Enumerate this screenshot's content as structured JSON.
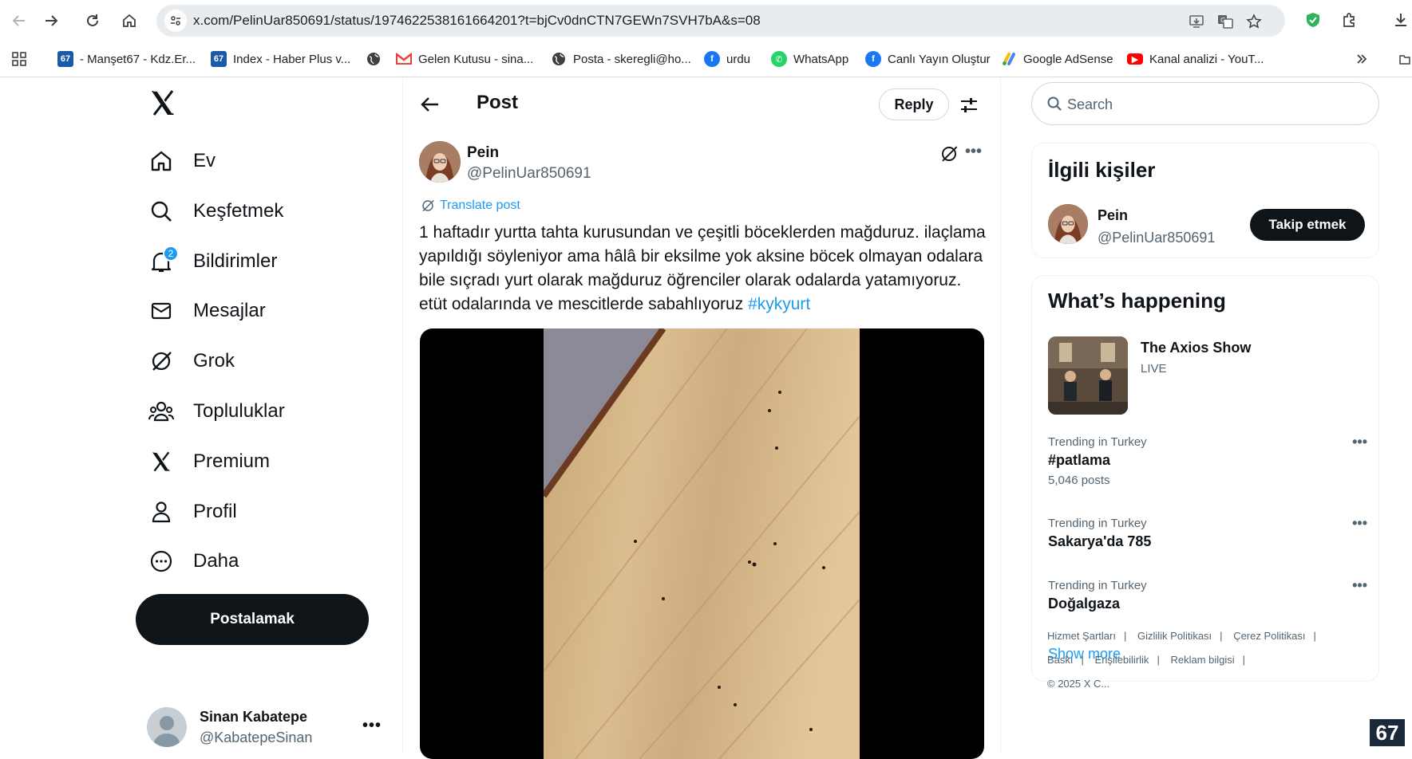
{
  "browser": {
    "url": "x.com/PelinUar850691/status/1974622538161664201?t=bjCv0dnCTN7GEWn7SVH7bA&s=08",
    "bookmarks": [
      {
        "label": "- Manşet67 - Kdz.Er...",
        "icon": "67-favicon"
      },
      {
        "label": "Index - Haber Plus v...",
        "icon": "67-favicon"
      },
      {
        "label": "Gelen Kutusu - sina...",
        "icon": "gmail-icon"
      },
      {
        "label": "Posta - skeregli@ho...",
        "icon": "globe-icon"
      },
      {
        "label": "urdu",
        "icon": "facebook-icon"
      },
      {
        "label": "WhatsApp",
        "icon": "whatsapp-icon"
      },
      {
        "label": "Canlı Yayın Oluştur",
        "icon": "facebook-icon"
      },
      {
        "label": "Google AdSense",
        "icon": "adsense-icon"
      },
      {
        "label": "Kanal analizi - YouT...",
        "icon": "youtube-icon"
      }
    ]
  },
  "nav": {
    "items": [
      {
        "label": "Ev",
        "icon": "home-icon"
      },
      {
        "label": "Keşfetmek",
        "icon": "search-icon"
      },
      {
        "label": "Bildirimler",
        "icon": "bell-icon",
        "badge": "2"
      },
      {
        "label": "Mesajlar",
        "icon": "mail-icon"
      },
      {
        "label": "Grok",
        "icon": "grok-icon"
      },
      {
        "label": "Topluluklar",
        "icon": "communities-icon"
      },
      {
        "label": "Premium",
        "icon": "x-logo-icon"
      },
      {
        "label": "Profil",
        "icon": "person-icon"
      },
      {
        "label": "Daha",
        "icon": "more-circle-icon"
      }
    ],
    "post_button": "Postalamak",
    "account": {
      "name": "Sinan Kabatepe",
      "handle": "@KabatepeSinan",
      "more": "•••"
    }
  },
  "post": {
    "header_title": "Post",
    "reply_label": "Reply",
    "author_name": "Pein",
    "author_handle": "@PelinUar850691",
    "more": "•••",
    "translate_label": "Translate post",
    "text": "1 haftadır yurtta tahta kurusundan ve çeşitli böceklerden mağduruz. ilaçlama yapıldığı söyleniyor ama hâlâ bir eksilme yok aksine böcek olmayan odalara bile sıçradı yurt olarak mağduruz öğrenciler olarak odalarda yatamıyoruz. etüt odalarında ve mescitlerde sabahlıyoruz",
    "hashtag": "#kykyurt"
  },
  "sidebar": {
    "search_placeholder": "Search",
    "related": {
      "title": "İlgili kişiler",
      "name": "Pein",
      "handle": "@PelinUar850691",
      "follow_label": "Takip etmek"
    },
    "happening": {
      "title": "What’s happening",
      "live": {
        "title": "The Axios Show",
        "badge": "LIVE"
      },
      "trends": [
        {
          "meta": "Trending in Turkey",
          "topic": "#patlama",
          "count": "5,046 posts"
        },
        {
          "meta": "Trending in Turkey",
          "topic": "Sakarya'da 785",
          "count": ""
        },
        {
          "meta": "Trending in Turkey",
          "topic": "Doğalgaza",
          "count": ""
        }
      ],
      "show_more": "Show more"
    },
    "footer": {
      "links": [
        "Hizmet Şartları",
        "Gizlilik Politikası",
        "Çerez Politikası",
        "Baskı",
        "Erişilebilirlik",
        "Reklam bilgisi"
      ],
      "copyright": "© 2025 X C..."
    }
  },
  "corner_logo": "67",
  "colors": {
    "accent": "#1d9bf0",
    "text": "#0f1419",
    "muted": "#536471",
    "button_dark": "#0f1419"
  }
}
